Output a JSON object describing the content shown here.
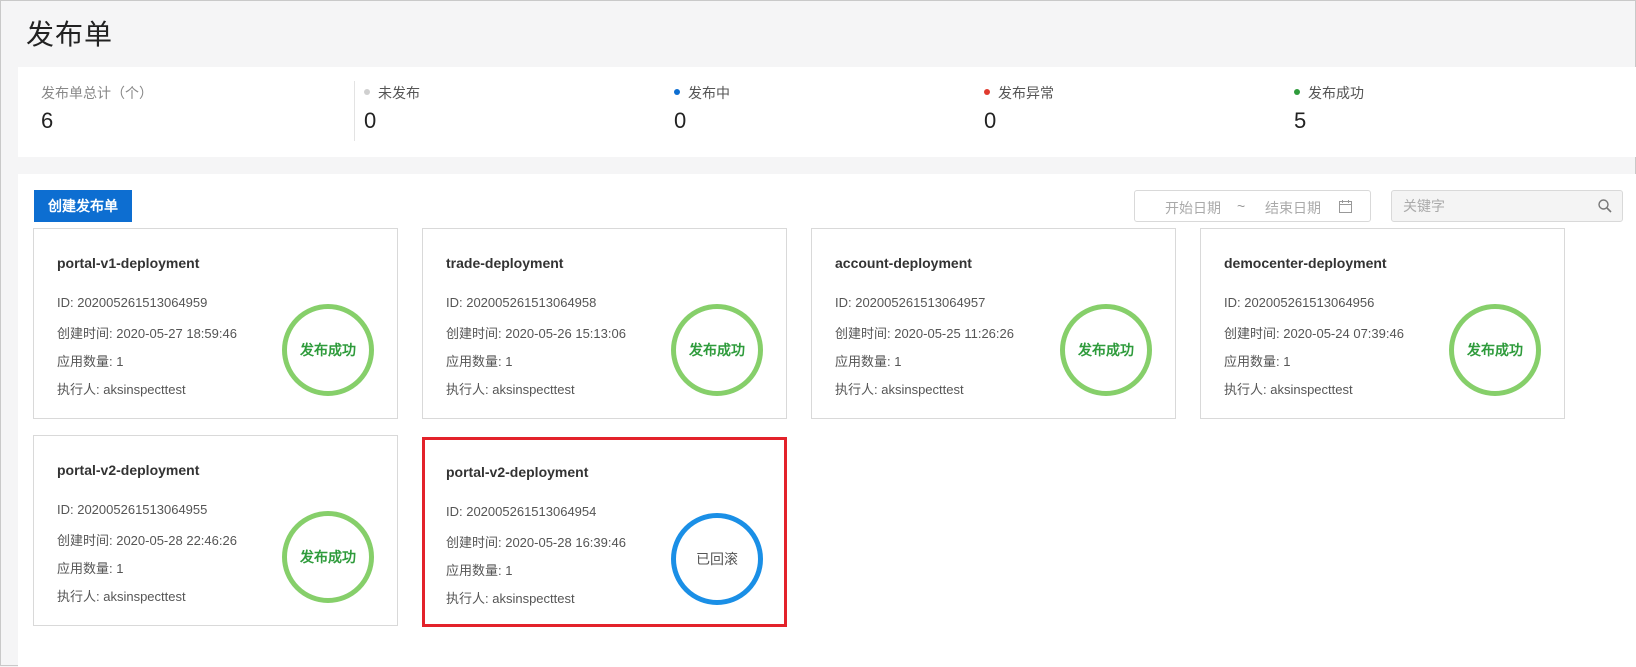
{
  "page": {
    "title": "发布单"
  },
  "stats": {
    "total": {
      "label": "发布单总计（个）",
      "value": "6"
    },
    "items": [
      {
        "label": "未发布",
        "value": "0",
        "color": "#d0d0d0"
      },
      {
        "label": "发布中",
        "value": "0",
        "color": "#0d6ed1"
      },
      {
        "label": "发布异常",
        "value": "0",
        "color": "#e03a2e"
      },
      {
        "label": "发布成功",
        "value": "5",
        "color": "#2e9b3b"
      }
    ]
  },
  "toolbar": {
    "create_label": "创建发布单",
    "date_start_placeholder": "开始日期",
    "date_separator": "~",
    "date_end_placeholder": "结束日期",
    "search_placeholder": "关键字"
  },
  "cards": [
    {
      "name": "portal-v1-deployment",
      "id": "ID: 202005261513064959",
      "created": "创建时间: 2020-05-27 18:59:46",
      "apps": "应用数量: 1",
      "executor": "执行人: aksinspecttest",
      "status": "发布成功",
      "status_color": "#86cf6a"
    },
    {
      "name": "trade-deployment",
      "id": "ID: 202005261513064958",
      "created": "创建时间: 2020-05-26 15:13:06",
      "apps": "应用数量: 1",
      "executor": "执行人: aksinspecttest",
      "status": "发布成功",
      "status_color": "#86cf6a"
    },
    {
      "name": "account-deployment",
      "id": "ID: 202005261513064957",
      "created": "创建时间: 2020-05-25 11:26:26",
      "apps": "应用数量: 1",
      "executor": "执行人: aksinspecttest",
      "status": "发布成功",
      "status_color": "#86cf6a"
    },
    {
      "name": "democenter-deployment",
      "id": "ID: 202005261513064956",
      "created": "创建时间: 2020-05-24 07:39:46",
      "apps": "应用数量: 1",
      "executor": "执行人: aksinspecttest",
      "status": "发布成功",
      "status_color": "#86cf6a"
    },
    {
      "name": "portal-v2-deployment",
      "id": "ID: 202005261513064955",
      "created": "创建时间: 2020-05-28 22:46:26",
      "apps": "应用数量: 1",
      "executor": "执行人: aksinspecttest",
      "status": "发布成功",
      "status_color": "#86cf6a"
    },
    {
      "name": "portal-v2-deployment",
      "id": "ID: 202005261513064954",
      "created": "创建时间: 2020-05-28 16:39:46",
      "apps": "应用数量: 1",
      "executor": "执行人: aksinspecttest",
      "status": "已回滚",
      "status_color": "#1a8fe6",
      "highlight_color": "#e3222a"
    }
  ]
}
